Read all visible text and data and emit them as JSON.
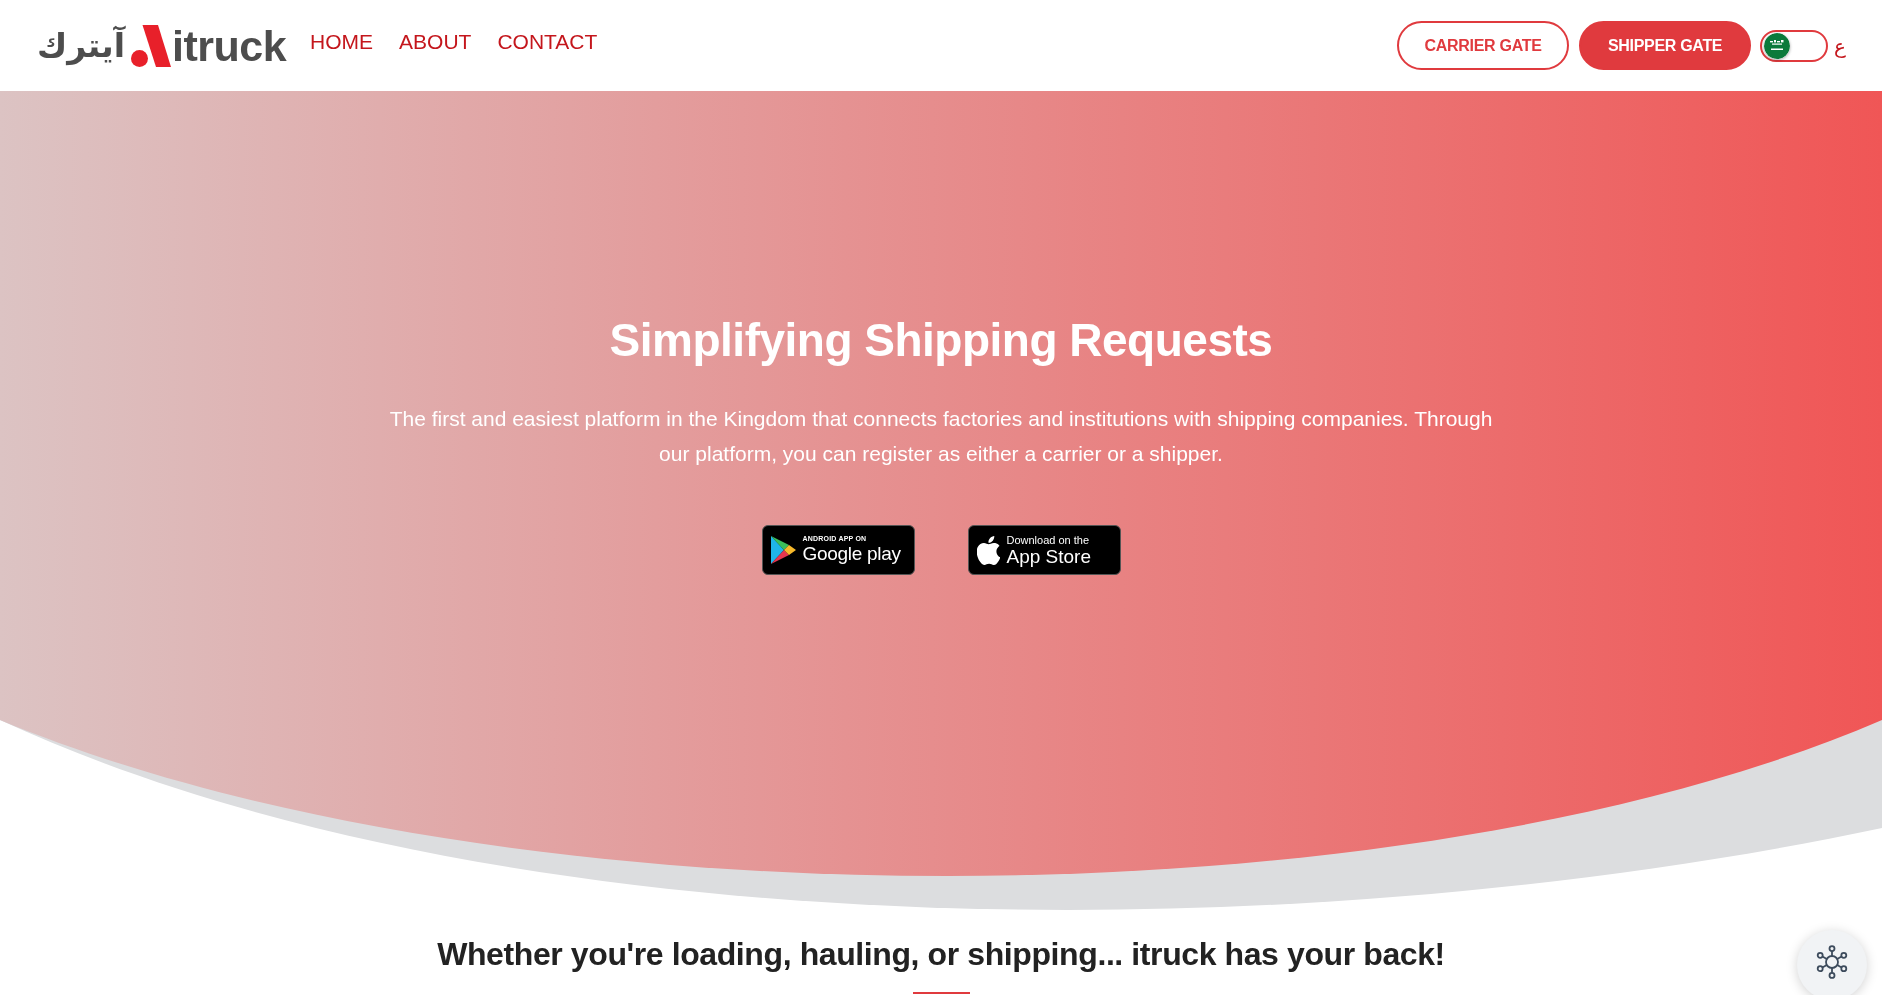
{
  "header": {
    "logo": {
      "arabic": "آيترك",
      "latin": "itruck"
    },
    "nav": [
      {
        "label": "HOME"
      },
      {
        "label": "ABOUT"
      },
      {
        "label": "CONTACT"
      }
    ],
    "gates": [
      {
        "label": "CARRIER GATE",
        "kind": "outline"
      },
      {
        "label": "SHIPPER GATE",
        "kind": "filled"
      }
    ],
    "language_toggle": {
      "on": false,
      "label": "ع"
    }
  },
  "hero": {
    "title": "Simplifying Shipping Requests",
    "description": "The first and easiest platform in the Kingdom that connects factories and institutions with shipping companies. Through our platform, you can register as either a carrier or a shipper.",
    "badges": [
      {
        "kind": "google_play",
        "caption": "ANDROID APP ON",
        "store": "Google play"
      },
      {
        "kind": "app_store",
        "caption": "Download on the",
        "store": "App Store"
      }
    ]
  },
  "section": {
    "heading": "Whether you're loading, hauling, or shipping... itruck has your back!"
  }
}
